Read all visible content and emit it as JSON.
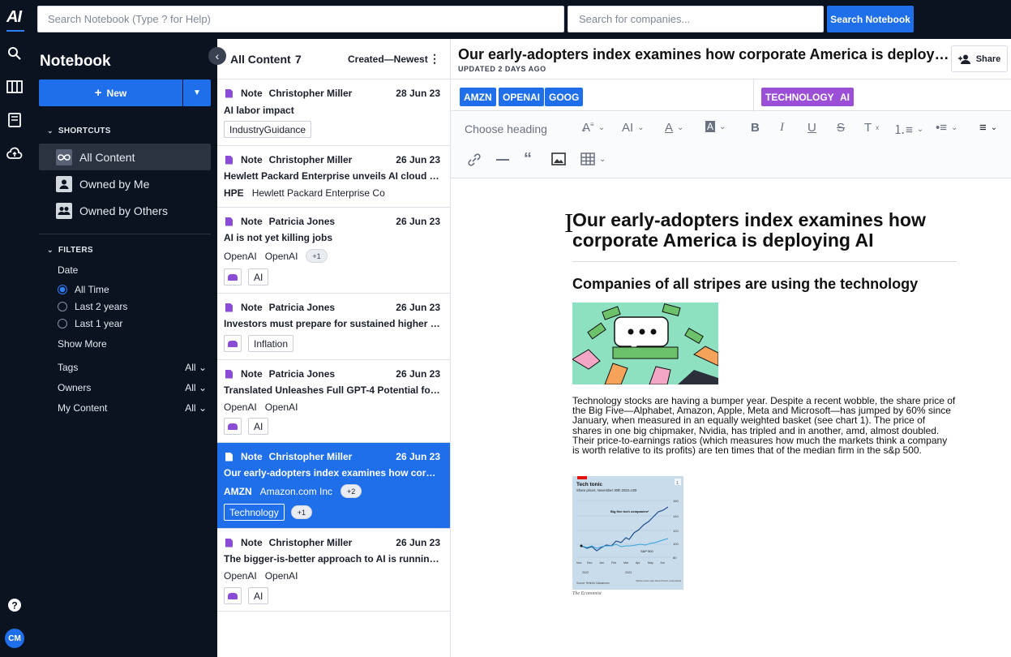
{
  "topbar": {
    "logo": "AI",
    "search_placeholder": "Search Notebook (Type ? for Help)",
    "company_search_placeholder": "Search for companies...",
    "search_button": "Search Notebook"
  },
  "user": {
    "initials": "CM"
  },
  "sidebar": {
    "title": "Notebook",
    "new_button": "New",
    "shortcuts_heading": "SHORTCUTS",
    "shortcuts": [
      {
        "label": "All Content",
        "active": true
      },
      {
        "label": "Owned by Me",
        "active": false
      },
      {
        "label": "Owned by Others",
        "active": false
      }
    ],
    "filters_heading": "FILTERS",
    "date_label": "Date",
    "date_options": [
      {
        "label": "All Time",
        "selected": true
      },
      {
        "label": "Last 2 years",
        "selected": false
      },
      {
        "label": "Last 1 year",
        "selected": false
      }
    ],
    "show_more": "Show More",
    "filter_rows": [
      {
        "label": "Tags",
        "value": "All"
      },
      {
        "label": "Owners",
        "value": "All"
      },
      {
        "label": "My Content",
        "value": "All"
      }
    ]
  },
  "list": {
    "title": "All Content",
    "count": "7",
    "sort": "Created—Newest",
    "items": [
      {
        "kind": "Note",
        "author": "Christopher Miller",
        "date": "28 Jun 23",
        "title": "AI labor impact",
        "ticker": "",
        "company": "",
        "extra": "",
        "tags": [
          "IndustryGuidance"
        ],
        "tag_more": ""
      },
      {
        "kind": "Note",
        "author": "Christopher Miller",
        "date": "26 Jun 23",
        "title": "Hewlett Packard Enterprise unveils AI cloud fo...",
        "ticker": "HPE",
        "company": "Hewlett Packard Enterprise Co",
        "extra": "",
        "tags": [],
        "tag_more": ""
      },
      {
        "kind": "Note",
        "author": "Patricia Jones",
        "date": "26 Jun 23",
        "title": "AI is not yet killing jobs",
        "ticker": "OpenAI",
        "company": "OpenAI",
        "extra": "+1",
        "tags": [
          "AI"
        ],
        "tag_more": ""
      },
      {
        "kind": "Note",
        "author": "Patricia Jones",
        "date": "26 Jun 23",
        "title": "Investors must prepare for sustained higher in...",
        "ticker": "",
        "company": "",
        "extra": "",
        "tags": [
          "Inflation"
        ],
        "tag_more": ""
      },
      {
        "kind": "Note",
        "author": "Patricia Jones",
        "date": "26 Jun 23",
        "title": "Translated Unleashes Full GPT-4 Potential for ...",
        "ticker": "OpenAI",
        "company": "OpenAI",
        "extra": "",
        "tags": [
          "AI"
        ],
        "tag_more": ""
      },
      {
        "kind": "Note",
        "author": "Christopher Miller",
        "date": "26 Jun 23",
        "title": "Our early-adopters index examines how corpo...",
        "ticker": "AMZN",
        "company": "Amazon.com Inc",
        "extra": "+2",
        "tags": [
          "Technology"
        ],
        "tag_more": "+1"
      },
      {
        "kind": "Note",
        "author": "Christopher Miller",
        "date": "26 Jun 23",
        "title": "The bigger-is-better approach to AI is running ...",
        "ticker": "OpenAI",
        "company": "OpenAI",
        "extra": "",
        "tags": [
          "AI"
        ],
        "tag_more": ""
      }
    ]
  },
  "editor": {
    "title": "Our early-adopters index examines how corporate America is deploying...",
    "updated": "UPDATED 2 DAYS AGO",
    "share": "Share",
    "company_chips": [
      "AMZN",
      "OPENAI",
      "GOOG"
    ],
    "tag_chips": [
      "TECHNOLOGY",
      "AI"
    ],
    "heading_select": "Choose heading",
    "doc": {
      "h1": "Our early-adopters index examines how corporate America is deploying AI",
      "h2": "Companies of all stripes are using the technology",
      "paragraph": "Technology stocks are having a bumper year. Despite a recent wobble, the share price of the Big Five—Alphabet, Amazon, Apple, Meta and Microsoft—has jumped by 60% since January, when measured in an equally weighted basket (see chart 1). The price of shares in one big chipmaker, Nvidia, has tripled and in another, amd, almost doubled. Their price-to-earnings ratios (which measures how much the markets think a company is worth relative to its profits) are ten times that of the median firm in the s&p 500.",
      "chart": {
        "title": "Tech tonic",
        "subtitle": "Share prices, November 30th 2022=100",
        "badge": "1",
        "series1": "Big five tech companies*",
        "series2": "S&P 500",
        "yticks": [
          "160",
          "140",
          "120",
          "100",
          "80"
        ],
        "xticks": [
          "Nov",
          "Dec",
          "Jan",
          "Feb",
          "Mar",
          "Apr",
          "May",
          "Jun"
        ],
        "years": [
          "2022",
          "2023"
        ],
        "footnote": "*Alphabet, Amazon, Apple, Meta and Microsoft, equally weighted",
        "source": "Source: Refinitiv Datastream"
      },
      "image_credit": "The Economist"
    }
  },
  "colors": {
    "accent": "#1f6feb",
    "tag_purple": "#9b4fd6",
    "dark_bg": "#0b1220"
  }
}
